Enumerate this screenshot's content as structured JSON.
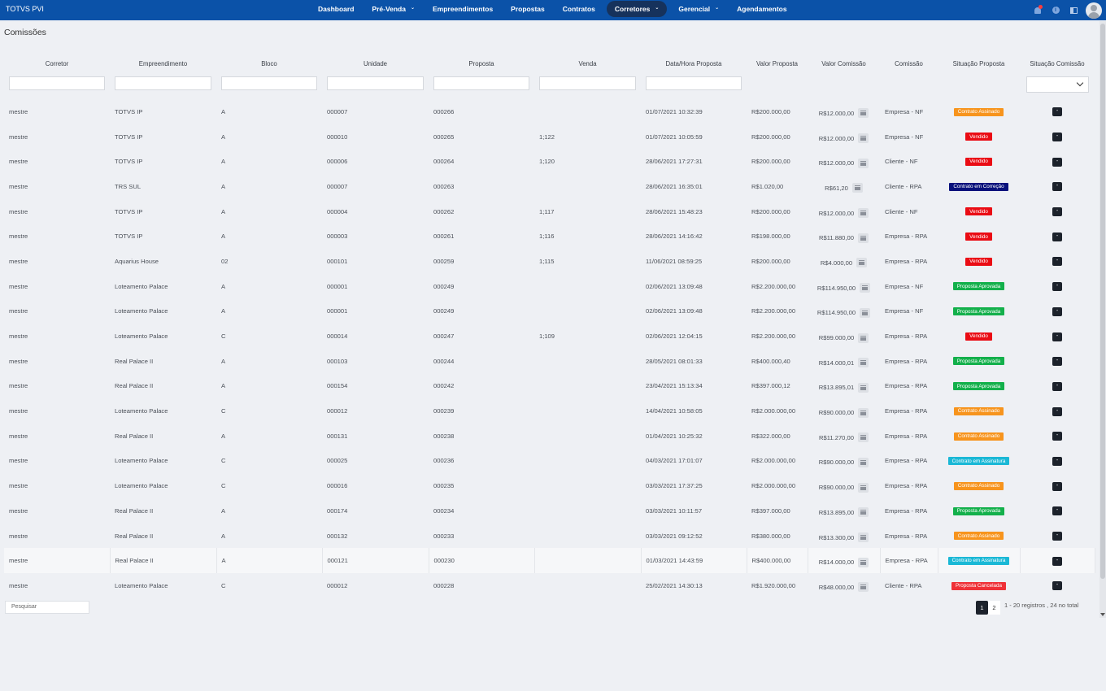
{
  "brand": "TOTVS PVI",
  "nav": [
    {
      "label": "Dashboard",
      "caret": false,
      "active": false
    },
    {
      "label": "Pré-Venda",
      "caret": true,
      "active": false
    },
    {
      "label": "Empreendimentos",
      "caret": false,
      "active": false
    },
    {
      "label": "Propostas",
      "caret": false,
      "active": false
    },
    {
      "label": "Contratos",
      "caret": false,
      "active": false
    },
    {
      "label": "Corretores",
      "caret": true,
      "active": true
    },
    {
      "label": "Gerencial",
      "caret": true,
      "active": false
    },
    {
      "label": "Agendamentos",
      "caret": false,
      "active": false
    }
  ],
  "header_icons": [
    "bell-icon",
    "info-icon",
    "panel-icon",
    "avatar-icon"
  ],
  "colors": {
    "nav_bg": "#0b52a8",
    "active_nav": "#16325c",
    "status": {
      "Contrato Assinado": "#f7941d",
      "Vendido": "#ea0c14",
      "Contrato em Correção": "#08117c",
      "Proposta Aprovada": "#13b04b",
      "Contrato em Assinatura": "#1ab8d6",
      "Proposta Cancelada": "#ef3138"
    }
  },
  "page_title": "Comissões",
  "columns": [
    "Corretor",
    "Empreendimento",
    "Bloco",
    "Unidade",
    "Proposta",
    "Venda",
    "Data/Hora Proposta",
    "Valor Proposta",
    "Valor Comissão",
    "Comissão",
    "Situação Proposta",
    "Situação Comissão"
  ],
  "rows": [
    {
      "corretor": "mestre",
      "empreendimento": "TOTVS IP",
      "bloco": "A",
      "unidade": "000007",
      "proposta": "000266",
      "venda": "",
      "data": "01/07/2021 10:32:39",
      "valor_proposta": "R$200.000,00",
      "valor_comissao": "R$12.000,00",
      "comissao": "Empresa - NF",
      "situacao": "Contrato Assinado",
      "sc": "-"
    },
    {
      "corretor": "mestre",
      "empreendimento": "TOTVS IP",
      "bloco": "A",
      "unidade": "000010",
      "proposta": "000265",
      "venda": "1;122",
      "data": "01/07/2021 10:05:59",
      "valor_proposta": "R$200.000,00",
      "valor_comissao": "R$12.000,00",
      "comissao": "Empresa - NF",
      "situacao": "Vendido",
      "sc": "-"
    },
    {
      "corretor": "mestre",
      "empreendimento": "TOTVS IP",
      "bloco": "A",
      "unidade": "000006",
      "proposta": "000264",
      "venda": "1;120",
      "data": "28/06/2021 17:27:31",
      "valor_proposta": "R$200.000,00",
      "valor_comissao": "R$12.000,00",
      "comissao": "Cliente - NF",
      "situacao": "Vendido",
      "sc": "-"
    },
    {
      "corretor": "mestre",
      "empreendimento": "TRS SUL",
      "bloco": "A",
      "unidade": "000007",
      "proposta": "000263",
      "venda": "",
      "data": "28/06/2021 16:35:01",
      "valor_proposta": "R$1.020,00",
      "valor_comissao": "R$61,20",
      "comissao": "Cliente - RPA",
      "situacao": "Contrato em Correção",
      "sc": "-"
    },
    {
      "corretor": "mestre",
      "empreendimento": "TOTVS IP",
      "bloco": "A",
      "unidade": "000004",
      "proposta": "000262",
      "venda": "1;117",
      "data": "28/06/2021 15:48:23",
      "valor_proposta": "R$200.000,00",
      "valor_comissao": "R$12.000,00",
      "comissao": "Cliente - NF",
      "situacao": "Vendido",
      "sc": "-"
    },
    {
      "corretor": "mestre",
      "empreendimento": "TOTVS IP",
      "bloco": "A",
      "unidade": "000003",
      "proposta": "000261",
      "venda": "1;116",
      "data": "28/06/2021 14:16:42",
      "valor_proposta": "R$198.000,00",
      "valor_comissao": "R$11.880,00",
      "comissao": "Empresa - RPA",
      "situacao": "Vendido",
      "sc": "-"
    },
    {
      "corretor": "mestre",
      "empreendimento": "Aquarius House",
      "bloco": "02",
      "unidade": "000101",
      "proposta": "000259",
      "venda": "1;115",
      "data": "11/06/2021 08:59:25",
      "valor_proposta": "R$200.000,00",
      "valor_comissao": "R$4.000,00",
      "comissao": "Empresa - RPA",
      "situacao": "Vendido",
      "sc": "-"
    },
    {
      "corretor": "mestre",
      "empreendimento": "Loteamento Palace",
      "bloco": "A",
      "unidade": "000001",
      "proposta": "000249",
      "venda": "",
      "data": "02/06/2021 13:09:48",
      "valor_proposta": "R$2.200.000,00",
      "valor_comissao": "R$114.950,00",
      "comissao": "Empresa - NF",
      "situacao": "Proposta Aprovada",
      "sc": "-"
    },
    {
      "corretor": "mestre",
      "empreendimento": "Loteamento Palace",
      "bloco": "A",
      "unidade": "000001",
      "proposta": "000249",
      "venda": "",
      "data": "02/06/2021 13:09:48",
      "valor_proposta": "R$2.200.000,00",
      "valor_comissao": "R$114.950,00",
      "comissao": "Empresa - NF",
      "situacao": "Proposta Aprovada",
      "sc": "-"
    },
    {
      "corretor": "mestre",
      "empreendimento": "Loteamento Palace",
      "bloco": "C",
      "unidade": "000014",
      "proposta": "000247",
      "venda": "1;109",
      "data": "02/06/2021 12:04:15",
      "valor_proposta": "R$2.200.000,00",
      "valor_comissao": "R$99.000,00",
      "comissao": "Empresa - RPA",
      "situacao": "Vendido",
      "sc": "-"
    },
    {
      "corretor": "mestre",
      "empreendimento": "Real Palace II",
      "bloco": "A",
      "unidade": "000103",
      "proposta": "000244",
      "venda": "",
      "data": "28/05/2021 08:01:33",
      "valor_proposta": "R$400.000,40",
      "valor_comissao": "R$14.000,01",
      "comissao": "Empresa - RPA",
      "situacao": "Proposta Aprovada",
      "sc": "-"
    },
    {
      "corretor": "mestre",
      "empreendimento": "Real Palace II",
      "bloco": "A",
      "unidade": "000154",
      "proposta": "000242",
      "venda": "",
      "data": "23/04/2021 15:13:34",
      "valor_proposta": "R$397.000,12",
      "valor_comissao": "R$13.895,01",
      "comissao": "Empresa - RPA",
      "situacao": "Proposta Aprovada",
      "sc": "-"
    },
    {
      "corretor": "mestre",
      "empreendimento": "Loteamento Palace",
      "bloco": "C",
      "unidade": "000012",
      "proposta": "000239",
      "venda": "",
      "data": "14/04/2021 10:58:05",
      "valor_proposta": "R$2.000.000,00",
      "valor_comissao": "R$90.000,00",
      "comissao": "Empresa - RPA",
      "situacao": "Contrato Assinado",
      "sc": "-"
    },
    {
      "corretor": "mestre",
      "empreendimento": "Real Palace II",
      "bloco": "A",
      "unidade": "000131",
      "proposta": "000238",
      "venda": "",
      "data": "01/04/2021 10:25:32",
      "valor_proposta": "R$322.000,00",
      "valor_comissao": "R$11.270,00",
      "comissao": "Empresa - RPA",
      "situacao": "Contrato Assinado",
      "sc": "-"
    },
    {
      "corretor": "mestre",
      "empreendimento": "Loteamento Palace",
      "bloco": "C",
      "unidade": "000025",
      "proposta": "000236",
      "venda": "",
      "data": "04/03/2021 17:01:07",
      "valor_proposta": "R$2.000.000,00",
      "valor_comissao": "R$90.000,00",
      "comissao": "Empresa - RPA",
      "situacao": "Contrato em Assinatura",
      "sc": "-"
    },
    {
      "corretor": "mestre",
      "empreendimento": "Loteamento Palace",
      "bloco": "C",
      "unidade": "000016",
      "proposta": "000235",
      "venda": "",
      "data": "03/03/2021 17:37:25",
      "valor_proposta": "R$2.000.000,00",
      "valor_comissao": "R$90.000,00",
      "comissao": "Empresa - RPA",
      "situacao": "Contrato Assinado",
      "sc": "-"
    },
    {
      "corretor": "mestre",
      "empreendimento": "Real Palace II",
      "bloco": "A",
      "unidade": "000174",
      "proposta": "000234",
      "venda": "",
      "data": "03/03/2021 10:11:57",
      "valor_proposta": "R$397.000,00",
      "valor_comissao": "R$13.895,00",
      "comissao": "Empresa - RPA",
      "situacao": "Proposta Aprovada",
      "sc": "-"
    },
    {
      "corretor": "mestre",
      "empreendimento": "Real Palace II",
      "bloco": "A",
      "unidade": "000132",
      "proposta": "000233",
      "venda": "",
      "data": "03/03/2021 09:12:52",
      "valor_proposta": "R$380.000,00",
      "valor_comissao": "R$13.300,00",
      "comissao": "Empresa - RPA",
      "situacao": "Contrato Assinado",
      "sc": "-"
    },
    {
      "corretor": "mestre",
      "empreendimento": "Real Palace II",
      "bloco": "A",
      "unidade": "000121",
      "proposta": "000230",
      "venda": "",
      "data": "01/03/2021 14:43:59",
      "valor_proposta": "R$400.000,00",
      "valor_comissao": "R$14.000,00",
      "comissao": "Empresa - RPA",
      "situacao": "Contrato em Assinatura",
      "sc": "-"
    },
    {
      "corretor": "mestre",
      "empreendimento": "Loteamento Palace",
      "bloco": "C",
      "unidade": "000012",
      "proposta": "000228",
      "venda": "",
      "data": "25/02/2021 14:30:13",
      "valor_proposta": "R$1.920.000,00",
      "valor_comissao": "R$48.000,00",
      "comissao": "Cliente - RPA",
      "situacao": "Proposta Cancelada",
      "sc": "-"
    }
  ],
  "highlighted_row": 18,
  "search": {
    "placeholder": "Pesquisar"
  },
  "pagination": {
    "pages": [
      "1",
      "2"
    ],
    "current": "1",
    "info": "1 - 20 registros , 24 no total"
  }
}
